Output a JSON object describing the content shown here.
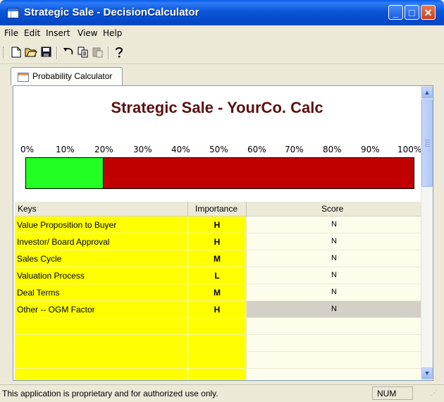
{
  "window": {
    "title": "Strategic Sale - DecisionCalculator"
  },
  "menu": [
    "File",
    "Edit",
    "Insert",
    "View",
    "Help"
  ],
  "toolbar": {
    "icons": [
      "new-document-icon",
      "open-folder-icon",
      "save-icon",
      "undo-icon",
      "copy-icon",
      "paste-icon",
      "help-icon"
    ]
  },
  "tab": {
    "label": "Probability Calculator"
  },
  "calc": {
    "heading": "Strategic Sale - YourCo. Calc",
    "scale": [
      "0%",
      "10%",
      "20%",
      "30%",
      "40%",
      "50%",
      "60%",
      "70%",
      "80%",
      "90%",
      "100%"
    ],
    "probability_percent": 20,
    "colors": {
      "fill": "#22ff22",
      "remainder": "#c00000",
      "heading": "#5b1010",
      "key_bg": "#ffff00"
    }
  },
  "table": {
    "columns": [
      "Keys",
      "Importance",
      "Score"
    ],
    "rows": [
      {
        "key": "Value Proposition to Buyer",
        "importance": "H",
        "score": "N"
      },
      {
        "key": "Investor/ Board Approval",
        "importance": "H",
        "score": "N"
      },
      {
        "key": "Sales Cycle",
        "importance": "M",
        "score": "N"
      },
      {
        "key": "Valuation Process",
        "importance": "L",
        "score": "N"
      },
      {
        "key": "Deal Terms",
        "importance": "M",
        "score": "N"
      },
      {
        "key": "Other -- OGM Factor",
        "importance": "H",
        "score": "N"
      }
    ],
    "selected_row": 5
  },
  "status": {
    "text": "This application is proprietary and for authorized use only.",
    "num": "NUM"
  }
}
